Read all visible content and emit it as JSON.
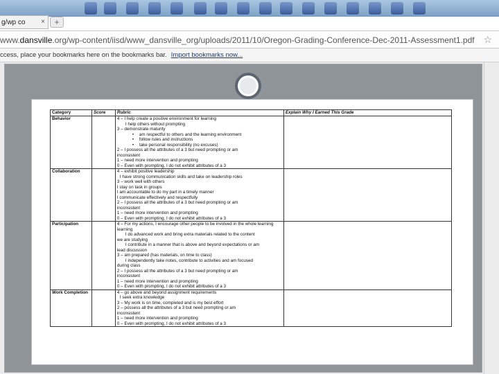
{
  "browser": {
    "tab_title": "g/wp co",
    "tab_close": "×",
    "new_tab": "+",
    "url_prefix": "www.",
    "url_domain": "dansville",
    "url_rest": ".org/wp-content/iisd/www_dansville_org/uploads/2011/10/Oregon-Grading-Conference-Dec-2011-Assessment1.pdf",
    "bookmarks_message": "ccess, place your bookmarks here on the bookmarks bar.",
    "bookmarks_link": "Import bookmarks now..."
  },
  "rubric": {
    "headers": {
      "category": "Category",
      "score": "Score",
      "rubric": "Rubric",
      "explain": "Explain Why I Earned This Grade"
    },
    "rows": [
      {
        "category": "Behavior",
        "lines": [
          {
            "cls": "",
            "text": "4 – I help create a positive environment for learning"
          },
          {
            "cls": "i2",
            "text": "I help others without prompting"
          },
          {
            "cls": "",
            "text": "3  –  demonstrate maturity"
          },
          {
            "cls": "bul",
            "text": "am respectful to others and the learning environment"
          },
          {
            "cls": "bul",
            "text": "follow rules and instructions"
          },
          {
            "cls": "bul",
            "text": "take personal responsibility (no excuses)"
          },
          {
            "cls": "",
            "text": "2 – I possess all the attributes of a 3 but need prompting or am"
          },
          {
            "cls": "",
            "text": "inconsistent"
          },
          {
            "cls": "",
            "text": "1 –  need more intervention and prompting"
          },
          {
            "cls": "",
            "text": "0 – Even with prompting, I do not exhibit attributes of a 3"
          }
        ]
      },
      {
        "category": "Collaboration",
        "lines": [
          {
            "cls": "",
            "text": "4 –  exhibit positive leadership"
          },
          {
            "cls": "i1",
            "text": "I have strong communication skills and take on leadership roles"
          },
          {
            "cls": "",
            "text": "3 –  work well with others"
          },
          {
            "cls": "",
            "text": "I stay on task in groups"
          },
          {
            "cls": "",
            "text": "I am accountable to do my part in a timely manner"
          },
          {
            "cls": "",
            "text": "I communicate effectively and respectfully"
          },
          {
            "cls": "",
            "text": "2 – I possess all the attributes of a 3 but need prompting or am"
          },
          {
            "cls": "",
            "text": "inconsistent"
          },
          {
            "cls": "",
            "text": "1  –  need more intervention and prompting"
          },
          {
            "cls": "",
            "text": "0 – Even with prompting, I do not exhibit attributes of a 3"
          }
        ]
      },
      {
        "category": "Participation",
        "lines": [
          {
            "cls": "",
            "text": "4 – For my actions, I encourage other people to be involved in the whole learning"
          },
          {
            "cls": "",
            "text": "learning"
          },
          {
            "cls": "i2",
            "text": "I do advanced work and bring extra materials related to the content"
          },
          {
            "cls": "",
            "text": "we are studying"
          },
          {
            "cls": "i2",
            "text": "I contribute in a manner that is above and beyond expectations or am"
          },
          {
            "cls": "",
            "text": "lead discussion"
          },
          {
            "cls": "",
            "text": "3 –  am prepared (has materials, on time to class)"
          },
          {
            "cls": "i2",
            "text": "I independently take notes, contribute to activities and am focused"
          },
          {
            "cls": "",
            "text": "during class"
          },
          {
            "cls": "",
            "text": "2 – I possess all the attributes of a 3 but need prompting or am"
          },
          {
            "cls": "",
            "text": "inconsistent"
          },
          {
            "cls": "",
            "text": "1  –  need more intervention and prompting"
          },
          {
            "cls": "",
            "text": "0 – Even with prompting, I do not exhibit attributes of a 3"
          }
        ]
      },
      {
        "category": "Work Completion",
        "lines": [
          {
            "cls": "",
            "text": "4 –  go above and beyond assignment requirements"
          },
          {
            "cls": "i1",
            "text": "I seek extra knowledge"
          },
          {
            "cls": "",
            "text": "3 – My work is on time, completed and is my best effort"
          },
          {
            "cls": "",
            "text": "2 –  possess all the attributes of a 3 but need prompting or am"
          },
          {
            "cls": "",
            "text": "inconsistent"
          },
          {
            "cls": "",
            "text": "1 –  need more intervention and prompting"
          },
          {
            "cls": "",
            "text": "0 – Even with prompting, I do not exhibit attributes of a 3"
          }
        ]
      }
    ]
  }
}
